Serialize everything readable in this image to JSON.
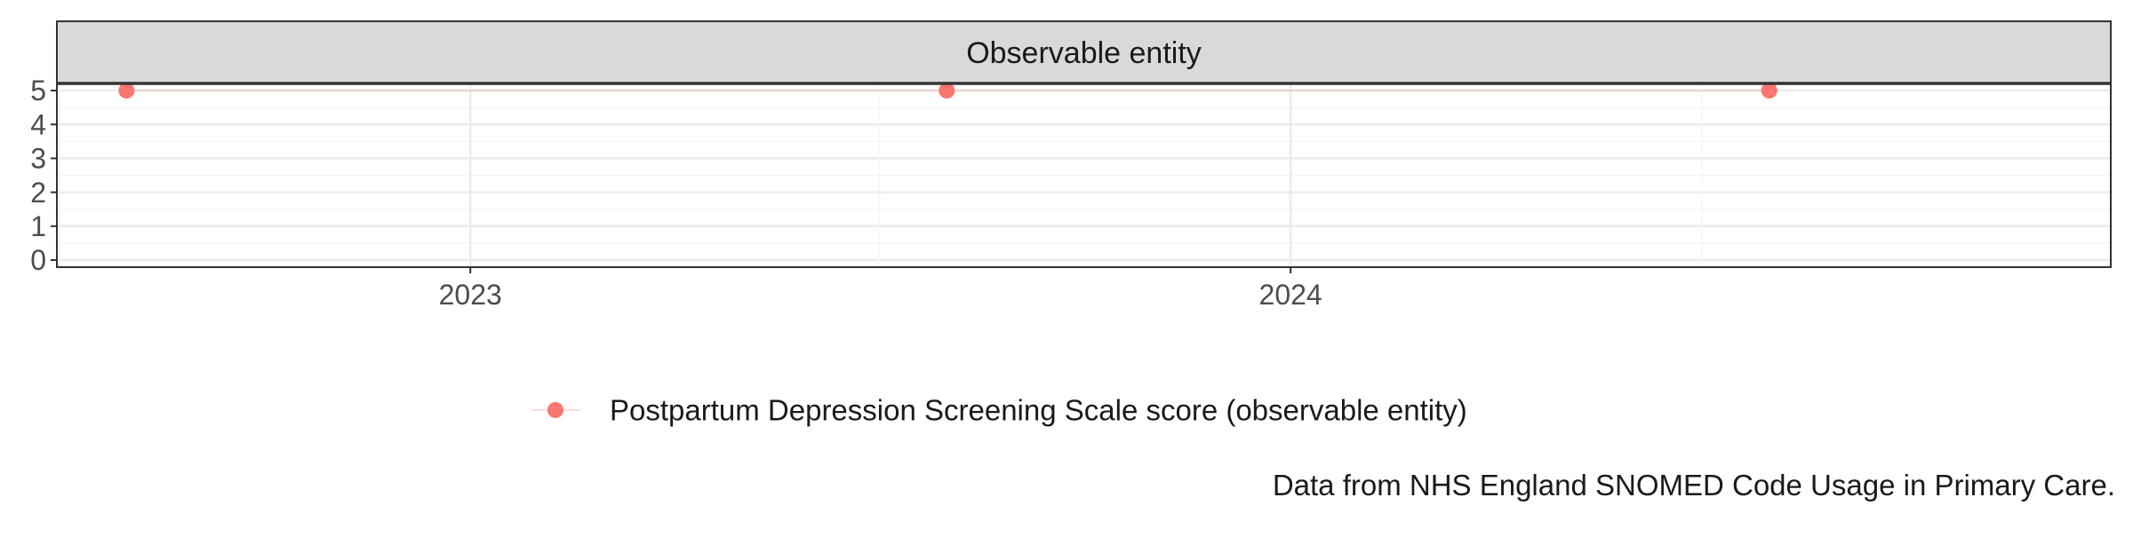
{
  "chart_data": {
    "type": "line",
    "facet_label": "Observable entity",
    "x_tick_labels": [
      "2023",
      "2024"
    ],
    "x_ticks": [
      "2023-01-01",
      "2024-01-01"
    ],
    "x_range": [
      "2022-07-01",
      "2024-12-31"
    ],
    "y_ticks": [
      0,
      1,
      2,
      3,
      4,
      5
    ],
    "y_tick_labels": [
      "0",
      "1",
      "2",
      "3",
      "4",
      "5"
    ],
    "ylim": [
      0,
      5
    ],
    "grid": true,
    "series": [
      {
        "name": "Postpartum Depression Screening Scale score (observable entity)",
        "color": "#F8766D",
        "points": [
          {
            "x": "2022-08-01",
            "y": 5
          },
          {
            "x": "2023-08-01",
            "y": 5
          },
          {
            "x": "2024-08-01",
            "y": 5
          }
        ]
      }
    ],
    "legend_position": "bottom",
    "caption": "Data from NHS England SNOMED Code Usage in Primary Care."
  },
  "colors": {
    "strip_fill": "#D9D9D9",
    "panel_border": "#333333",
    "grid_major": "#EBEBEB",
    "grid_minor": "#F5F5F5",
    "text": "#4D4D4D",
    "title_text": "#1A1A1A"
  }
}
